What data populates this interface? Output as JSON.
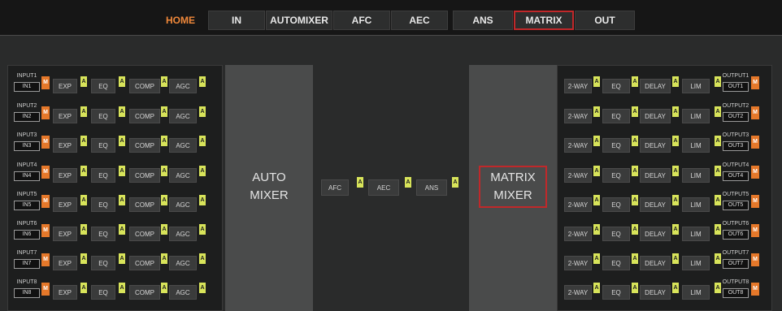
{
  "nav": {
    "home": "HOME",
    "in": "IN",
    "automixer": "AUTOMIXER",
    "afc": "AFC",
    "aec": "AEC",
    "ans": "ANS",
    "matrix": "MATRIX",
    "out": "OUT",
    "active_tab": "MATRIX"
  },
  "inputs": [
    {
      "name": "INPUT1",
      "ch": "IN1"
    },
    {
      "name": "INPUT2",
      "ch": "IN2"
    },
    {
      "name": "INPUT3",
      "ch": "IN3"
    },
    {
      "name": "INPUT4",
      "ch": "IN4"
    },
    {
      "name": "INPUT5",
      "ch": "IN5"
    },
    {
      "name": "INPUT6",
      "ch": "IN6"
    },
    {
      "name": "INPUT7",
      "ch": "IN7"
    },
    {
      "name": "INPUT8",
      "ch": "IN8"
    }
  ],
  "input_modules": {
    "mute": "M",
    "bypass": "A",
    "exp": "EXP",
    "eq": "EQ",
    "comp": "COMP",
    "agc": "AGC"
  },
  "outputs": [
    {
      "name": "OUTPUT1",
      "ch": "OUT1"
    },
    {
      "name": "OUTPUT2",
      "ch": "OUT2"
    },
    {
      "name": "OUTPUT3",
      "ch": "OUT3"
    },
    {
      "name": "OUTPUT4",
      "ch": "OUT4"
    },
    {
      "name": "OUTPUT5",
      "ch": "OUT5"
    },
    {
      "name": "OUTPUT6",
      "ch": "OUT6"
    },
    {
      "name": "OUTPUT7",
      "ch": "OUT7"
    },
    {
      "name": "OUTPUT8",
      "ch": "OUT8"
    }
  ],
  "output_modules": {
    "mute": "M",
    "bypass": "A",
    "twoway": "2-WAY",
    "eq": "EQ",
    "delay": "DELAY",
    "lim": "LIM"
  },
  "automixer": {
    "line1": "AUTO",
    "line2": "MIXER"
  },
  "matrix": {
    "line1": "MATRIX",
    "line2": "MIXER"
  },
  "center_modules": {
    "afc": "AFC",
    "aec": "AEC",
    "ans": "ANS",
    "bypass": "A"
  },
  "colors": {
    "mute": "#e5782a",
    "bypass": "#d8e45a",
    "active": "#c0282a",
    "home": "#f0883a"
  }
}
